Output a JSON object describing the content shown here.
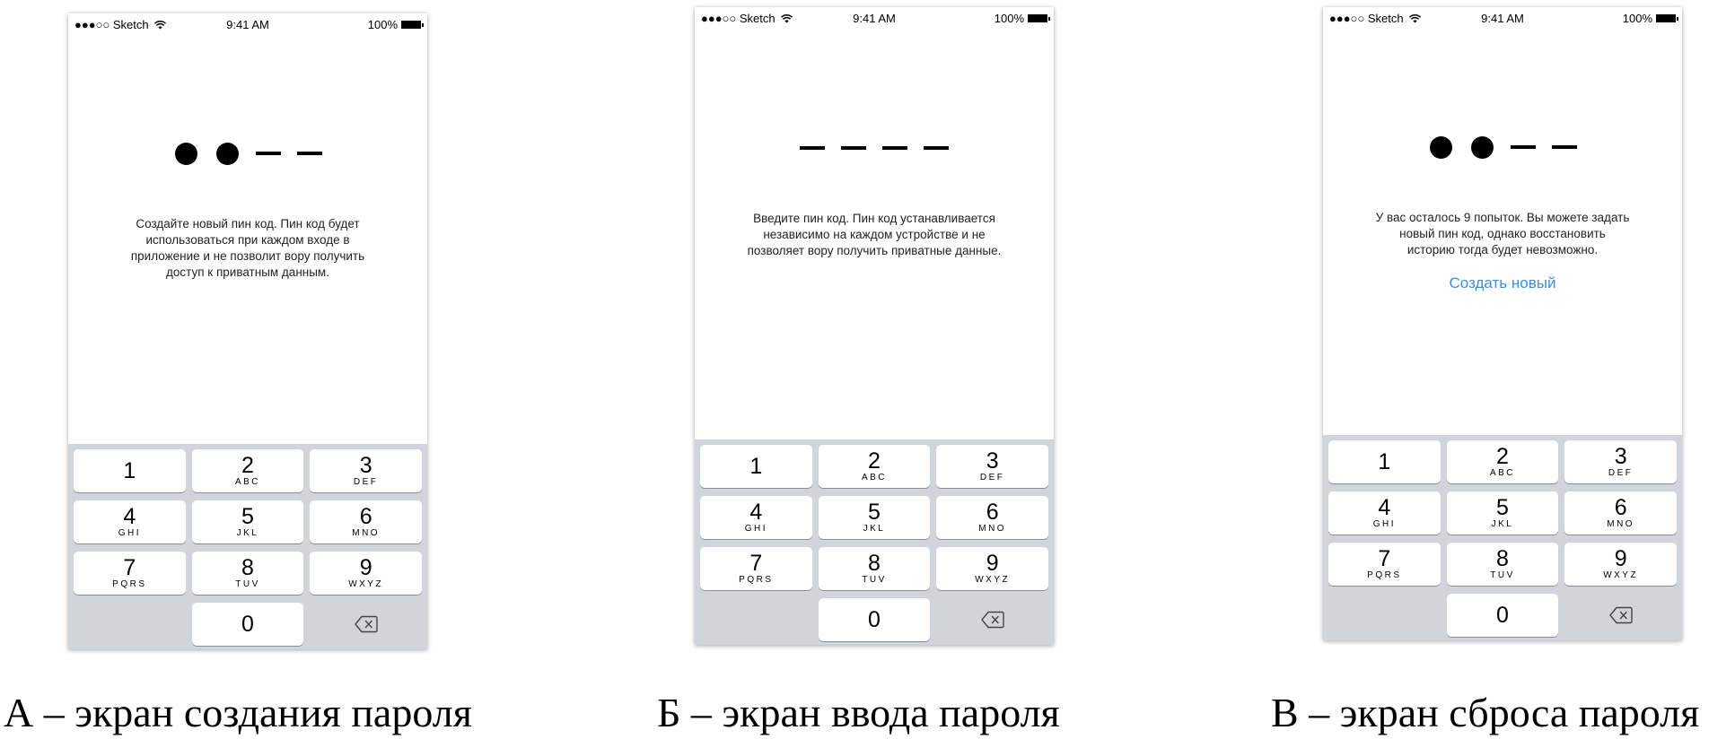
{
  "status": {
    "carrier": "●●●○○ Sketch",
    "time": "9:41 AM",
    "battery": "100%"
  },
  "keys": [
    {
      "num": "1",
      "letters": ""
    },
    {
      "num": "2",
      "letters": "ABC"
    },
    {
      "num": "3",
      "letters": "DEF"
    },
    {
      "num": "4",
      "letters": "GHI"
    },
    {
      "num": "5",
      "letters": "JKL"
    },
    {
      "num": "6",
      "letters": "MNO"
    },
    {
      "num": "7",
      "letters": "PQRS"
    },
    {
      "num": "8",
      "letters": "TUV"
    },
    {
      "num": "9",
      "letters": "WXYZ"
    },
    {
      "num": "0",
      "letters": ""
    }
  ],
  "screen_a": {
    "pins_filled": 2,
    "pins_total": 4,
    "description": "Создайте новый пин код. Пин код будет использоваться при каждом входе в приложение и не позволит вору получить доступ к приватным данным.",
    "caption": "А – экран создания пароля"
  },
  "screen_b": {
    "pins_filled": 0,
    "pins_total": 4,
    "description": "Введите пин код. Пин код устанавливается независимо на каждом устройстве и не позволяет вору получить приватные данные.",
    "caption": "Б – экран ввода пароля"
  },
  "screen_c": {
    "pins_filled": 2,
    "pins_total": 4,
    "description": "У вас осталось 9 попыток. Вы можете задать новый пин код, однако восстановить историю тогда будет невозможно.",
    "link": "Создать новый",
    "caption": "В – экран сброса пароля"
  },
  "colors": {
    "link": "#3d8fd6",
    "keypad_bg": "#d1d5db"
  }
}
